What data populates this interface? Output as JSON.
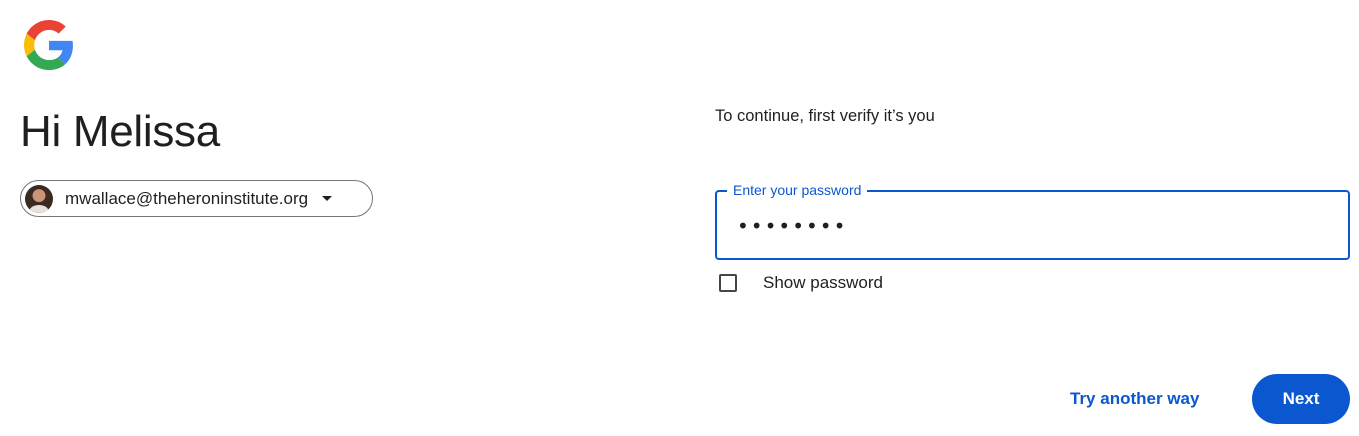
{
  "brand": {
    "logo_icon": "google-g-logo",
    "colors": {
      "blue": "#4285F4",
      "red": "#EA4335",
      "yellow": "#FBBC05",
      "green": "#34A853",
      "accent": "#0b57d0"
    }
  },
  "header": {
    "greeting": "Hi Melissa"
  },
  "account": {
    "email": "mwallace@theheroninstitute.org",
    "avatar_icon": "user-avatar",
    "dropdown_icon": "caret-down-icon"
  },
  "form": {
    "instruction": "To continue, first verify it’s you",
    "password_label": "Enter your password",
    "password_value": "••••••••",
    "show_password_label": "Show password",
    "show_password_checked": false
  },
  "actions": {
    "try_another_way": "Try another way",
    "next": "Next"
  }
}
